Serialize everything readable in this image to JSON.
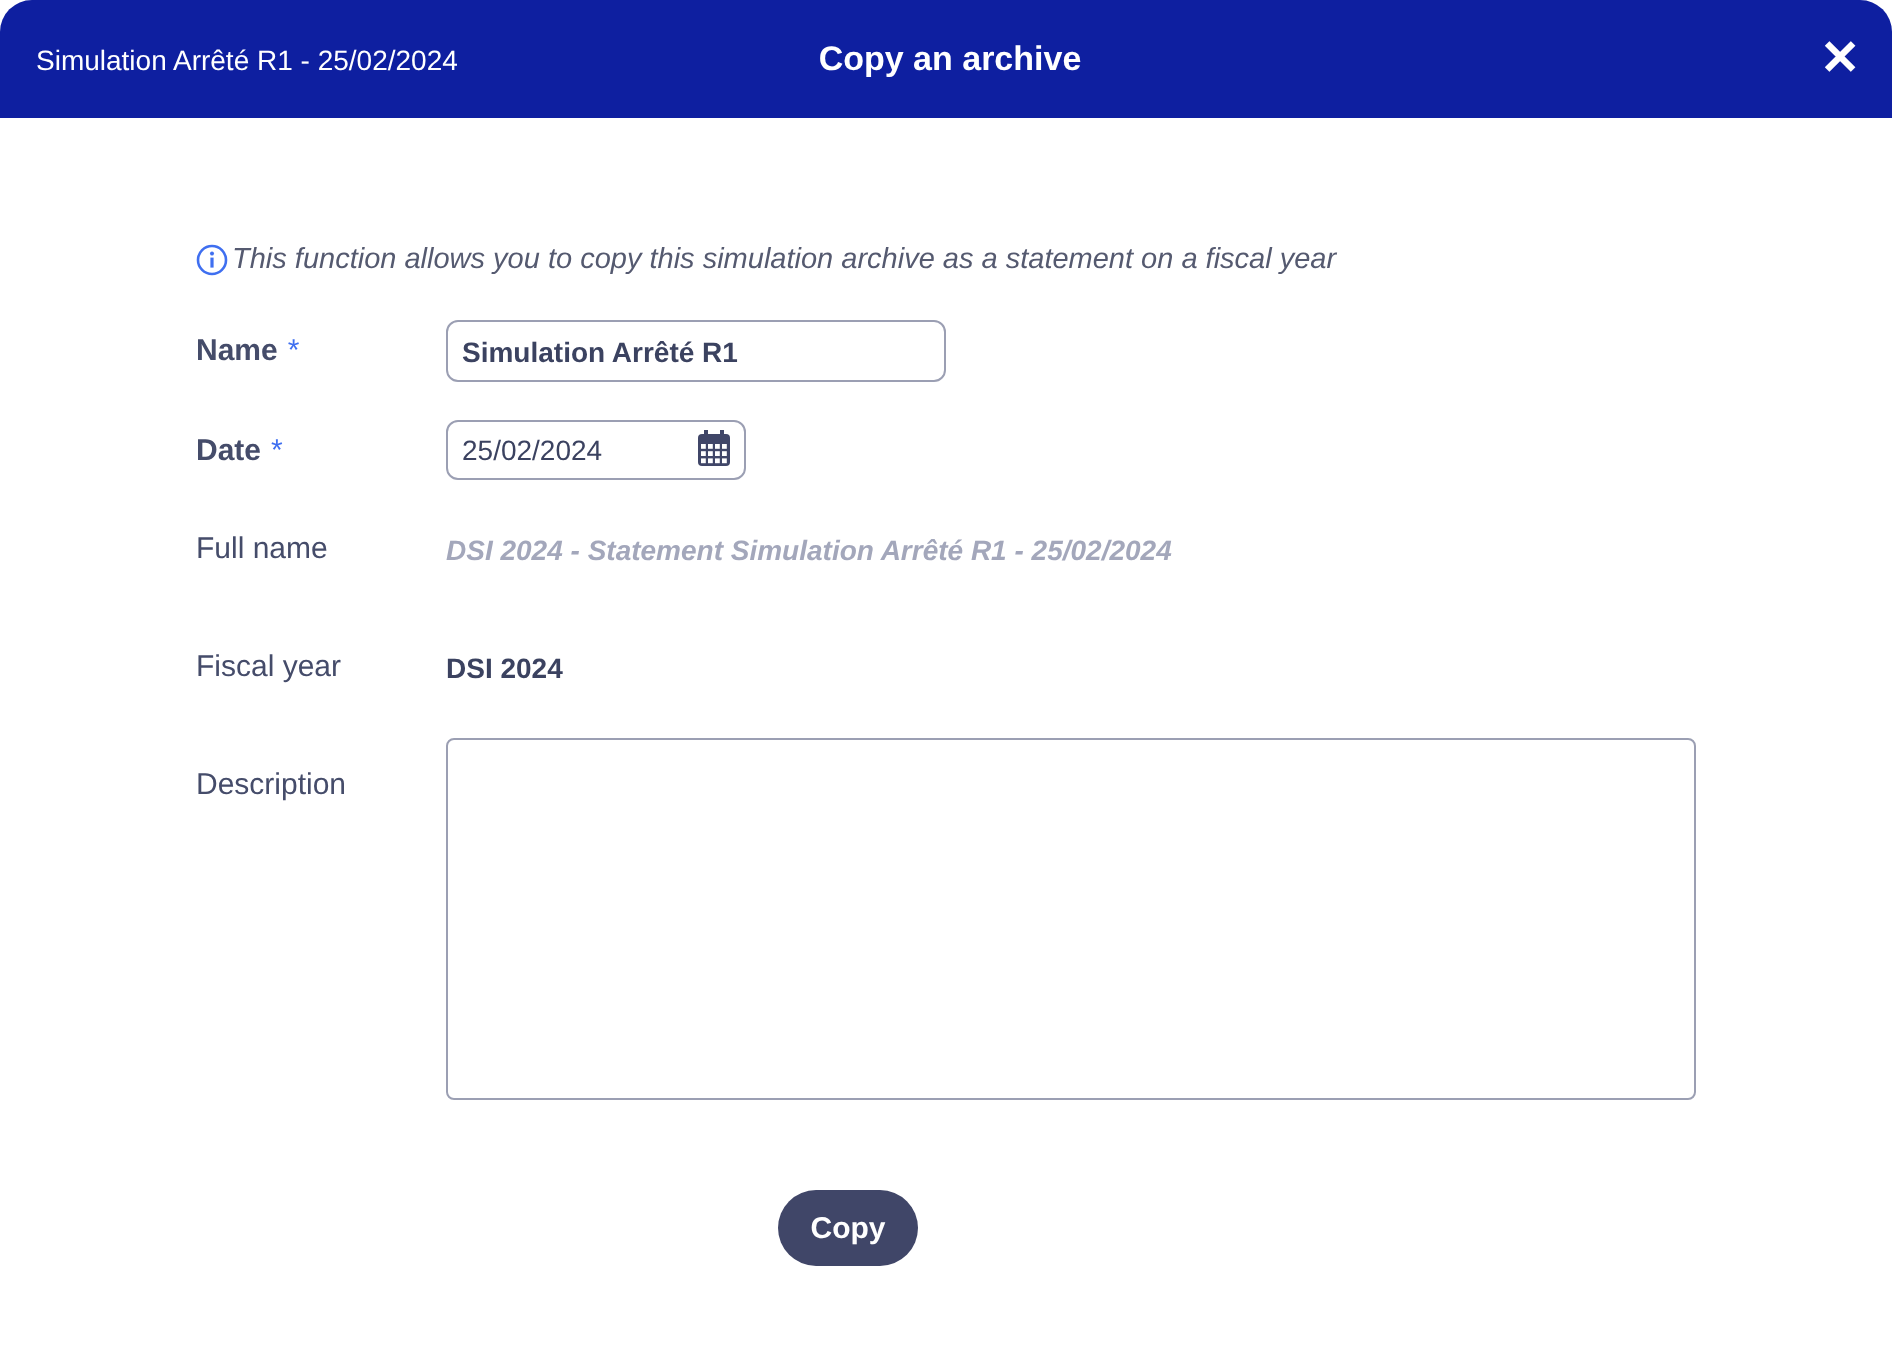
{
  "header": {
    "subtitle": "Simulation Arrêté R1 - 25/02/2024",
    "title": "Copy an archive",
    "close": "✕"
  },
  "info": "This function allows you to copy this simulation archive as a statement on a fiscal year",
  "fields": [
    {
      "kind": "text",
      "label": "Name",
      "required_mark": "*",
      "value": "Simulation Arrêté R1"
    },
    {
      "kind": "date",
      "label": "Date",
      "required_mark": "*",
      "value": "25/02/2024"
    },
    {
      "kind": "computed",
      "label": "Full name",
      "value": "DSI 2024 - Statement Simulation Arrêté R1 - 25/02/2024"
    },
    {
      "kind": "static",
      "label": "Fiscal year",
      "value": "DSI 2024"
    },
    {
      "kind": "textarea",
      "label": "Description"
    }
  ],
  "button": "Copy"
}
